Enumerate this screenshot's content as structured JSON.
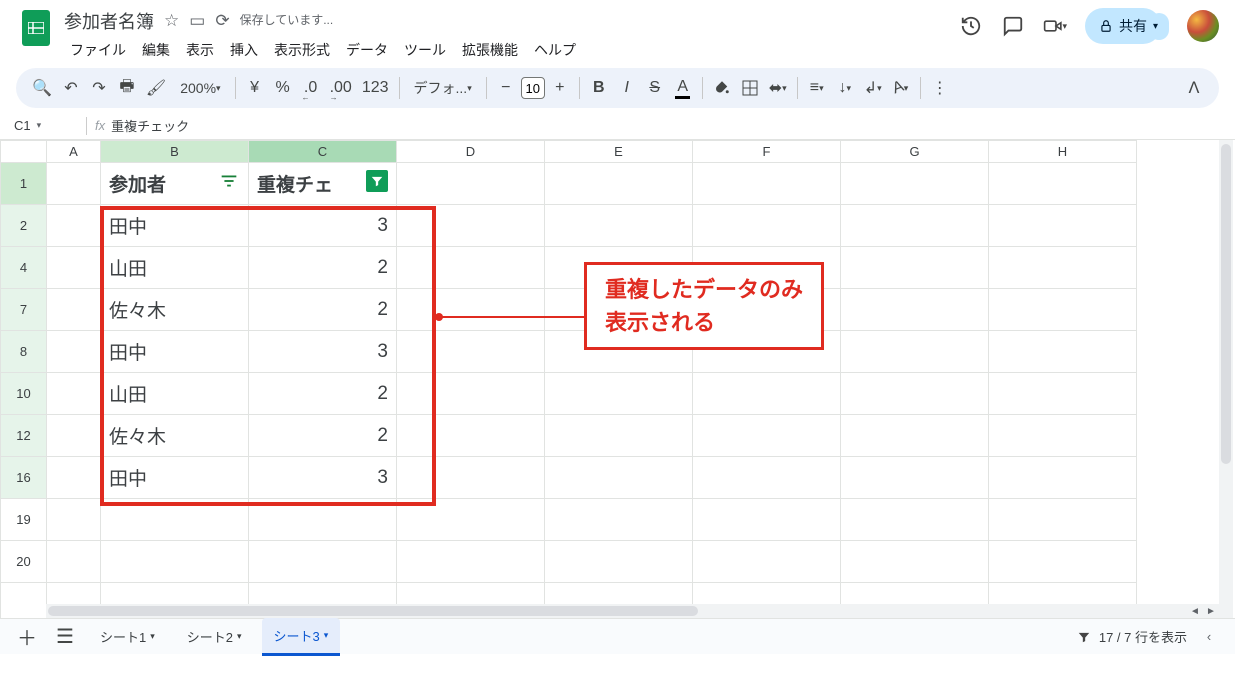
{
  "header": {
    "doc_title": "参加者名簿",
    "saving_text": "保存しています...",
    "share_label": "共有",
    "menus": [
      "ファイル",
      "編集",
      "表示",
      "挿入",
      "表示形式",
      "データ",
      "ツール",
      "拡張機能",
      "ヘルプ"
    ]
  },
  "toolbar": {
    "zoom": "200%",
    "currency": "¥",
    "percent": "%",
    "dec_dec": ".0",
    "dec_inc": ".00",
    "num123": "123",
    "font_name": "デフォ...",
    "font_size": "10",
    "minus": "−",
    "plus": "+"
  },
  "namebox": {
    "cell": "C1",
    "fx_label": "fx",
    "formula": "重複チェック"
  },
  "columns": [
    "A",
    "B",
    "C",
    "D",
    "E",
    "F",
    "G",
    "H"
  ],
  "table": {
    "headers": {
      "row": "1",
      "b": "参加者",
      "c": "重複チェ"
    },
    "rows": [
      {
        "row": "2",
        "b": "田中",
        "c": "3"
      },
      {
        "row": "4",
        "b": "山田",
        "c": "2"
      },
      {
        "row": "7",
        "b": "佐々木",
        "c": "2"
      },
      {
        "row": "8",
        "b": "田中",
        "c": "3"
      },
      {
        "row": "10",
        "b": "山田",
        "c": "2"
      },
      {
        "row": "12",
        "b": "佐々木",
        "c": "2"
      },
      {
        "row": "16",
        "b": "田中",
        "c": "3"
      }
    ],
    "empty_rows": [
      "19",
      "20"
    ]
  },
  "callout_line1": "重複したデータのみ",
  "callout_line2": "表示される",
  "sheets": {
    "tabs": [
      {
        "label": "シート1",
        "active": false
      },
      {
        "label": "シート2",
        "active": false
      },
      {
        "label": "シート3",
        "active": true
      }
    ],
    "filter_status": "17 / 7 行を表示"
  }
}
